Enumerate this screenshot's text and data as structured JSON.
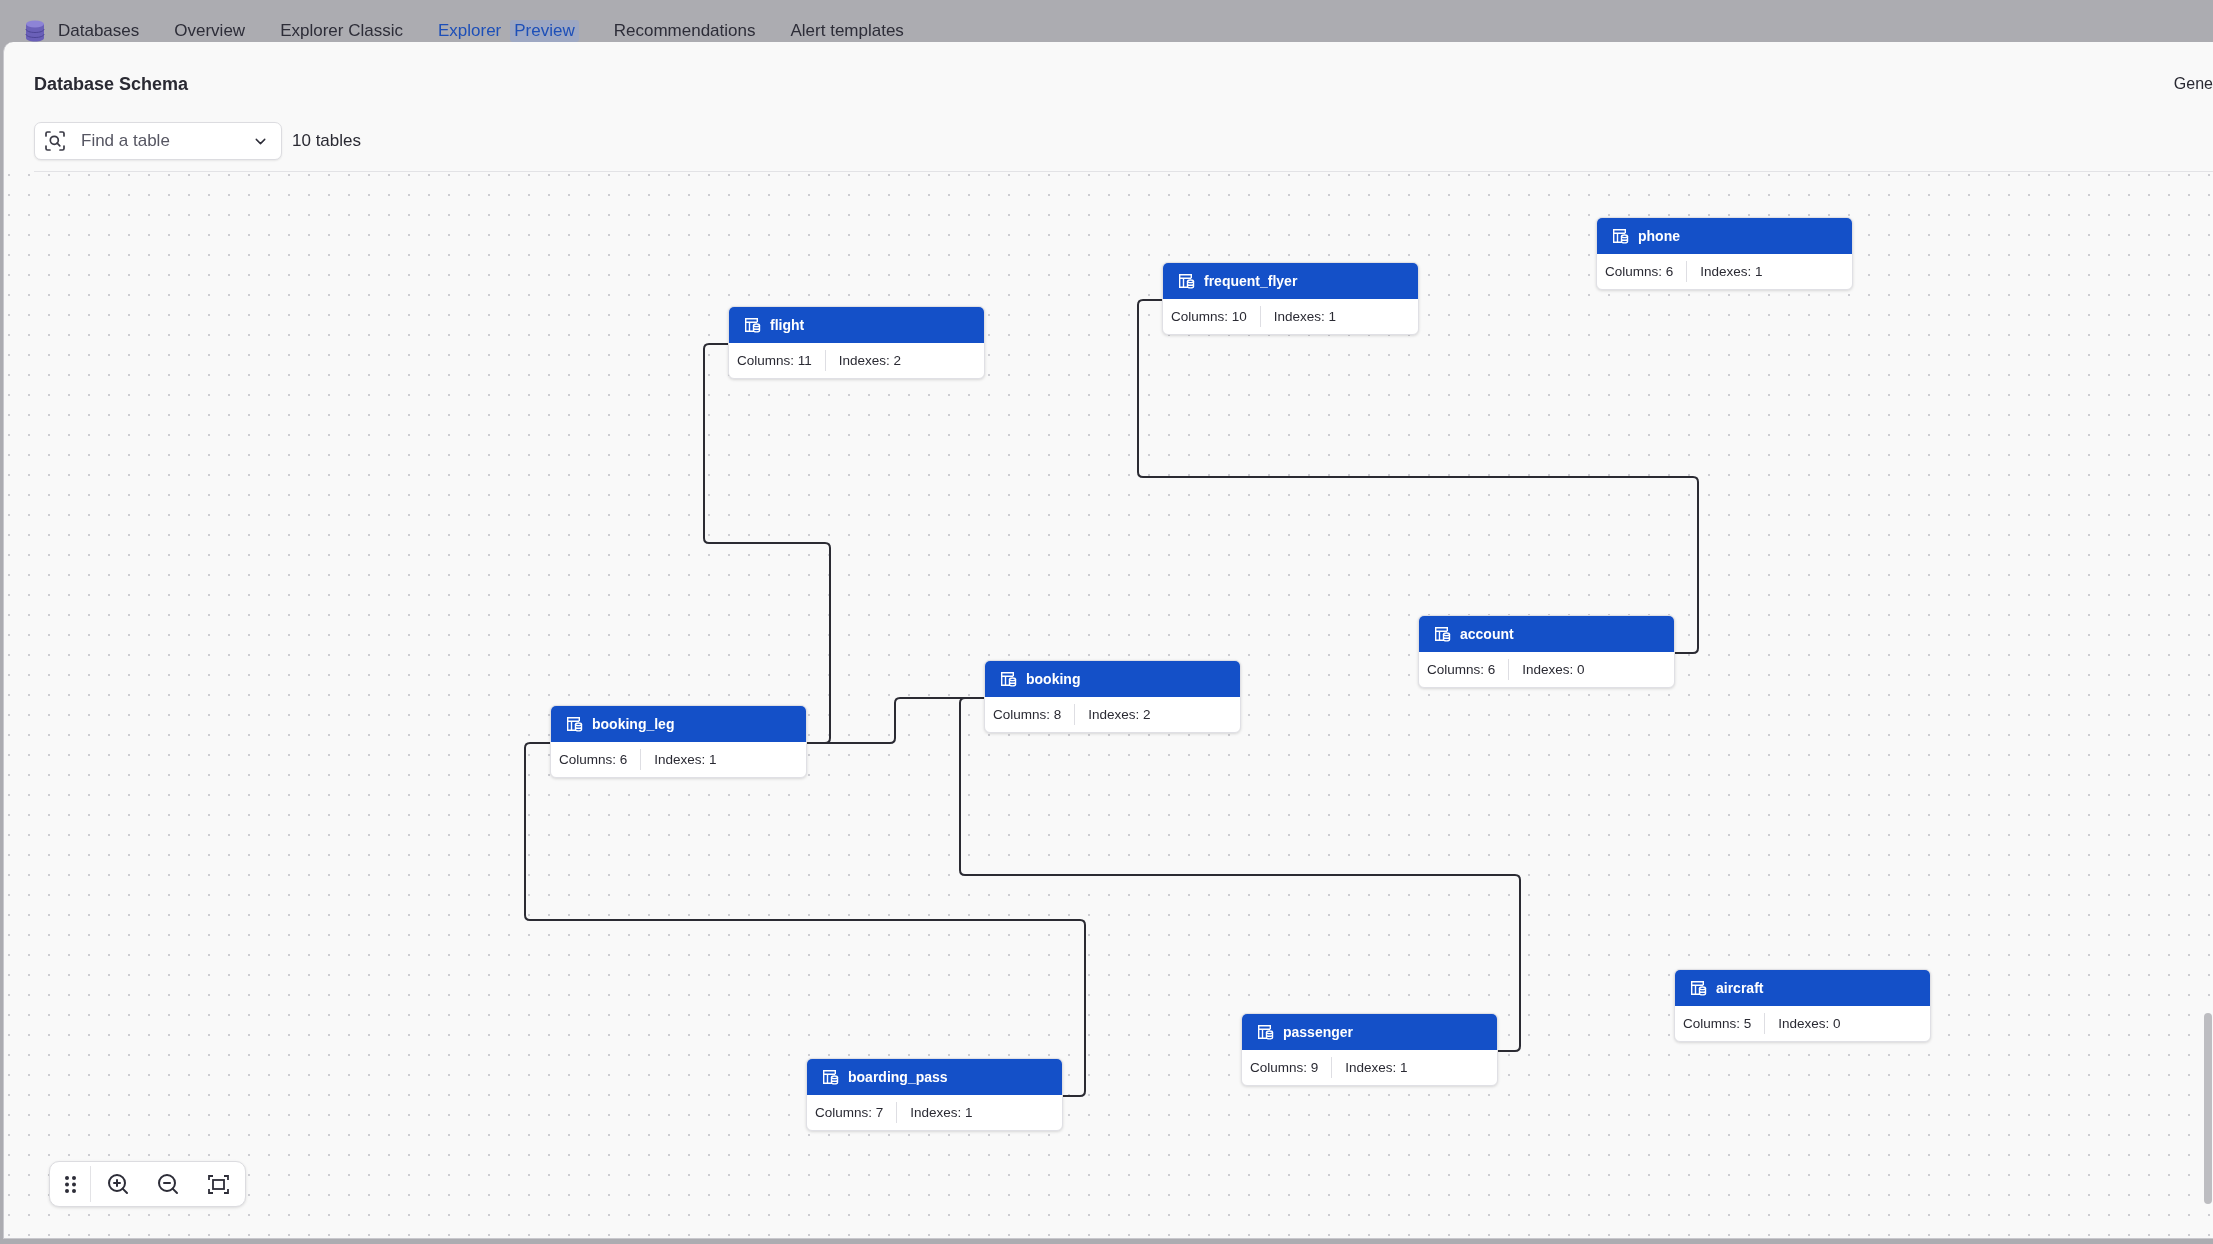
{
  "app": {
    "name": "Databases"
  },
  "nav": {
    "tabs": [
      {
        "label": "Overview",
        "selected": false
      },
      {
        "label": "Explorer Classic",
        "selected": false
      },
      {
        "label": "Explorer",
        "selected": true,
        "badge": "Preview"
      },
      {
        "label": "Recommendations",
        "selected": false
      },
      {
        "label": "Alert templates",
        "selected": false
      }
    ]
  },
  "header": {
    "title": "Database Schema",
    "side_text": "Gene"
  },
  "search": {
    "placeholder": "Find a table"
  },
  "table_count": "10 tables",
  "tables": [
    {
      "name": "phone",
      "columns": "Columns: 6",
      "indexes": "Indexes: 1"
    },
    {
      "name": "frequent_flyer",
      "columns": "Columns: 10",
      "indexes": "Indexes: 1"
    },
    {
      "name": "flight",
      "columns": "Columns: 11",
      "indexes": "Indexes: 2"
    },
    {
      "name": "account",
      "columns": "Columns: 6",
      "indexes": "Indexes: 0"
    },
    {
      "name": "booking",
      "columns": "Columns: 8",
      "indexes": "Indexes: 2"
    },
    {
      "name": "booking_leg",
      "columns": "Columns: 6",
      "indexes": "Indexes: 1"
    },
    {
      "name": "aircraft",
      "columns": "Columns: 5",
      "indexes": "Indexes: 0"
    },
    {
      "name": "passenger",
      "columns": "Columns: 9",
      "indexes": "Indexes: 1"
    },
    {
      "name": "boarding_pass",
      "columns": "Columns: 7",
      "indexes": "Indexes: 1"
    }
  ]
}
